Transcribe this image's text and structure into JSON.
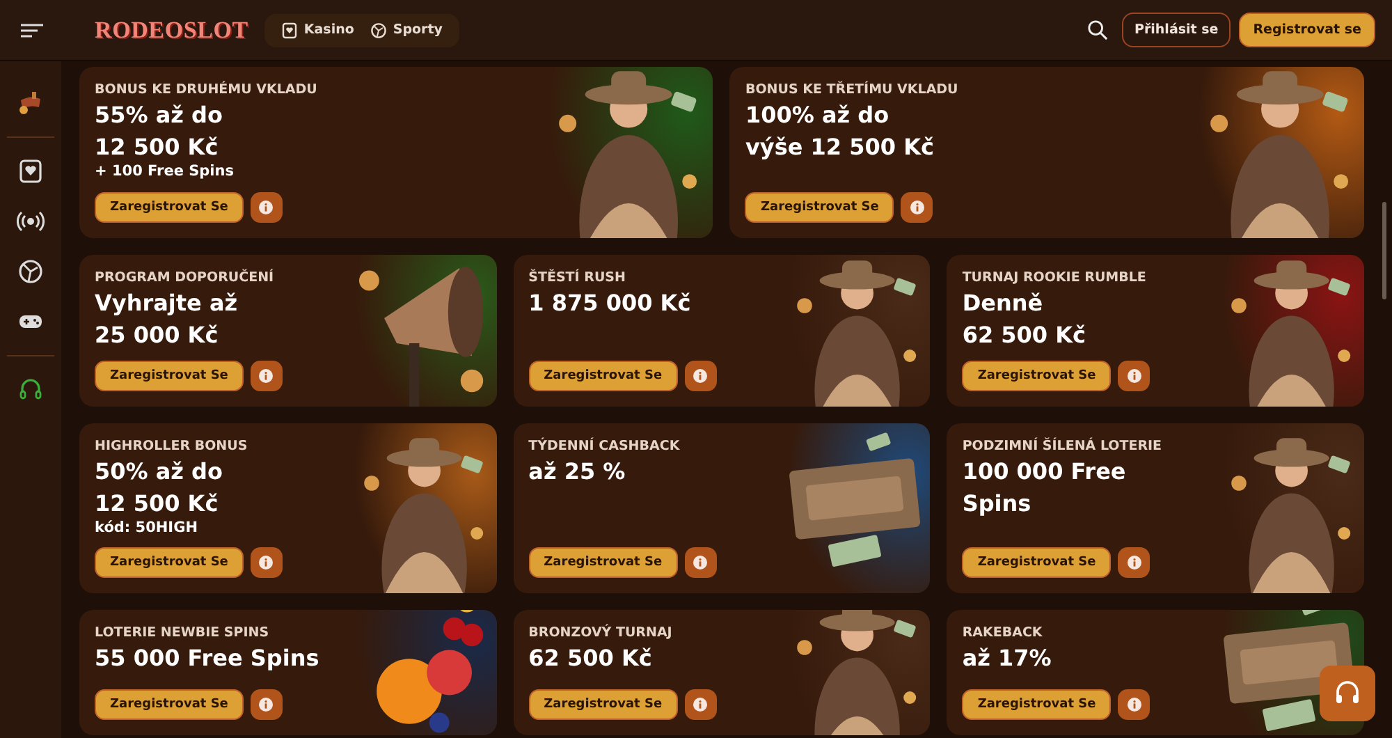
{
  "header": {
    "logo": "RODEOSLOT",
    "nav": [
      {
        "label": "Kasino",
        "kind": "casino"
      },
      {
        "label": "Sporty",
        "kind": "sport"
      }
    ],
    "login": "Přihlásit se",
    "register": "Registrovat se"
  },
  "promos": [
    {
      "title": "BONUS KE DRUHÉMU VKLADU",
      "headline": "55% až do\n12 500 Kč",
      "note": "+ 100 Free Spins",
      "button": "Zaregistrovat Se"
    },
    {
      "title": "BONUS KE TŘETÍMU VKLADU",
      "headline": "100% až do\nvýše 12 500 Kč",
      "button": "Zaregistrovat Se"
    },
    {
      "title": "PROGRAM DOPORUČENÍ",
      "headline": "Vyhrajte až\n25 000 Kč",
      "button": "Zaregistrovat Se"
    },
    {
      "title": "ŠTĚSTÍ RUSH",
      "headline": "1 875 000 Kč",
      "button": "Zaregistrovat Se"
    },
    {
      "title": "TURNAJ ROOKIE RUMBLE",
      "headline": "Denně\n62 500 Kč",
      "button": "Zaregistrovat Se"
    },
    {
      "title": "HIGHROLLER BONUS",
      "headline": "50% až do\n12 500 Kč",
      "note": "kód: 50HIGH",
      "button": "Zaregistrovat Se"
    },
    {
      "title": "TÝDENNÍ CASHBACK",
      "headline": "až 25 %",
      "button": "Zaregistrovat Se"
    },
    {
      "title": "PODZIMNÍ ŠÍLENÁ LOTERIE",
      "headline": "100 000 Free\nSpins",
      "button": "Zaregistrovat Se"
    },
    {
      "title": "LOTERIE NEWBIE SPINS",
      "headline": "55 000 Free Spins",
      "button": "Zaregistrovat Se"
    },
    {
      "title": "BRONZOVÝ TURNAJ",
      "headline": "62 500 Kč",
      "button": "Zaregistrovat Se"
    },
    {
      "title": "RAKEBACK",
      "headline": "až 17%",
      "button": "Zaregistrovat Se"
    }
  ]
}
